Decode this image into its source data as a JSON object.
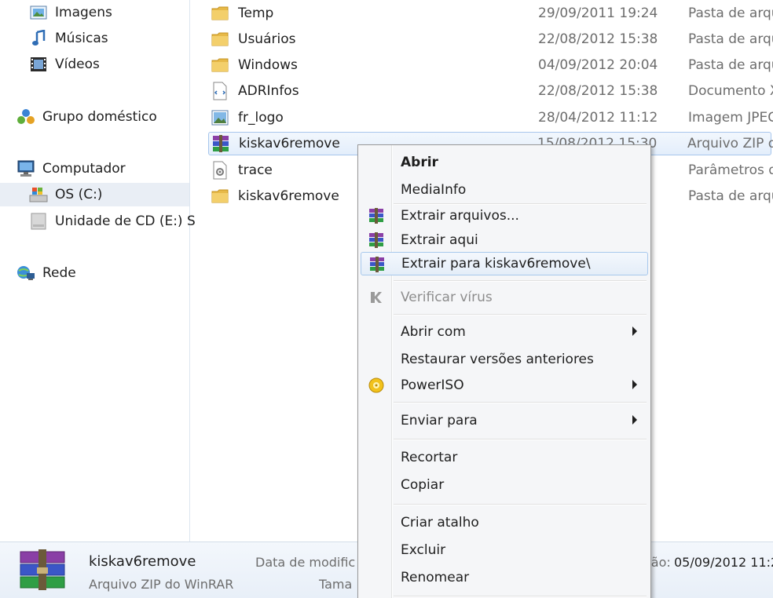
{
  "nav": {
    "items": [
      {
        "label": "Imagens",
        "icon": "pictures-icon"
      },
      {
        "label": "Músicas",
        "icon": "music-icon"
      },
      {
        "label": "Vídeos",
        "icon": "videos-icon"
      },
      {
        "label": "Grupo doméstico",
        "icon": "homegroup-icon"
      },
      {
        "label": "Computador",
        "icon": "computer-icon"
      },
      {
        "label": "OS (C:)",
        "icon": "windows-drive-icon"
      },
      {
        "label": "Unidade de CD (E:) S",
        "icon": "cd-drive-icon"
      },
      {
        "label": "Rede",
        "icon": "network-icon"
      }
    ]
  },
  "files": [
    {
      "name": "Temp",
      "date": "29/09/2011 19:24",
      "type": "Pasta de arqu",
      "icon": "folder-icon"
    },
    {
      "name": "Usuários",
      "date": "22/08/2012 15:38",
      "type": "Pasta de arqu",
      "icon": "folder-icon"
    },
    {
      "name": "Windows",
      "date": "04/09/2012 20:04",
      "type": "Pasta de arqu",
      "icon": "folder-icon"
    },
    {
      "name": "ADRInfos",
      "date": "22/08/2012 15:38",
      "type": "Documento X",
      "icon": "xml-document-icon"
    },
    {
      "name": "fr_logo",
      "date": "28/04/2012 11:12",
      "type": "Imagem JPEG",
      "icon": "image-file-icon"
    },
    {
      "name": "kiskav6remove",
      "date": "15/08/2012 15:30",
      "type": "Arquivo ZIP d",
      "icon": "winrar-archive-icon"
    },
    {
      "name": "trace",
      "date": "",
      "type": "Parâmetros d",
      "icon": "settings-file-icon"
    },
    {
      "name": "kiskav6remove",
      "date": "",
      "type": "Pasta de arqu",
      "icon": "folder-icon"
    }
  ],
  "details": {
    "name": "kiskav6remove",
    "type": "Arquivo ZIP do WinRAR",
    "label_modified": "Data de modific",
    "label_size": "Tama",
    "label_created": "ção:",
    "created_value": "05/09/2012 11:2"
  },
  "context_menu": {
    "items": [
      {
        "label": "Abrir",
        "bold": true
      },
      {
        "label": "MediaInfo"
      },
      {
        "label": "Extrair arquivos...",
        "icon": "winrar-icon"
      },
      {
        "label": "Extrair aqui",
        "icon": "winrar-icon"
      },
      {
        "label": "Extrair para kiskav6remove\\",
        "icon": "winrar-icon"
      },
      {
        "label": "Verificar vírus",
        "icon": "kaspersky-icon",
        "disabled": true
      },
      {
        "label": "Abrir com",
        "submenu": true
      },
      {
        "label": "Restaurar versões anteriores"
      },
      {
        "label": "PowerISO",
        "icon": "poweriso-icon",
        "submenu": true
      },
      {
        "label": "Enviar para",
        "submenu": true
      },
      {
        "label": "Recortar"
      },
      {
        "label": "Copiar"
      },
      {
        "label": "Criar atalho"
      },
      {
        "label": "Excluir"
      },
      {
        "label": "Renomear"
      }
    ]
  },
  "colors": {
    "selection_border": "#a7c6ec",
    "menu_background": "#f5f6f8",
    "secondary_text": "#6d6d6d"
  }
}
